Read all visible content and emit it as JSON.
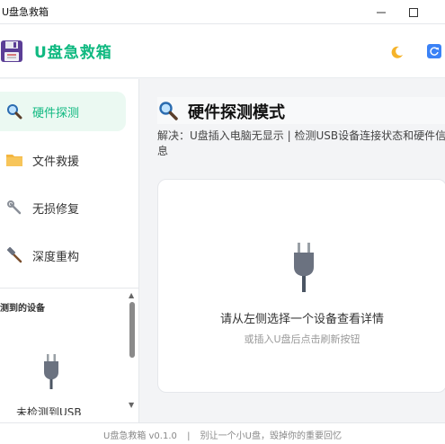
{
  "window": {
    "title": "U盘急救箱",
    "minimize_icon": "minimize-icon",
    "maximize_icon": "maximize-icon"
  },
  "header": {
    "app_title": "U盘急救箱",
    "logo_icon": "floppy-disk-icon",
    "theme_icon": "moon-icon",
    "refresh_icon": "refresh-icon",
    "accent_color": "#10b981"
  },
  "sidebar": {
    "items": [
      {
        "label": "硬件探测",
        "icon": "search-icon",
        "active": true
      },
      {
        "label": "文件救援",
        "icon": "folder-icon",
        "active": false
      },
      {
        "label": "无损修复",
        "icon": "wrench-icon",
        "active": false
      },
      {
        "label": "深度重构",
        "icon": "hammer-icon",
        "active": false
      }
    ],
    "detected_title": "测到的设备",
    "empty_text": "未检测到USB"
  },
  "main": {
    "title": "硬件探测模式",
    "description": "解决：U盘插入电脑无显示 | 检测USB设备连接状态和硬件信息",
    "card_main_text": "请从左侧选择一个设备查看详情",
    "card_sub_text": "或插入U盘后点击刷新按钮"
  },
  "footer": {
    "version": "U盘急救箱 v0.1.0",
    "separator": "|",
    "slogan": "别让一个小U盘，毁掉你的重要回忆"
  }
}
